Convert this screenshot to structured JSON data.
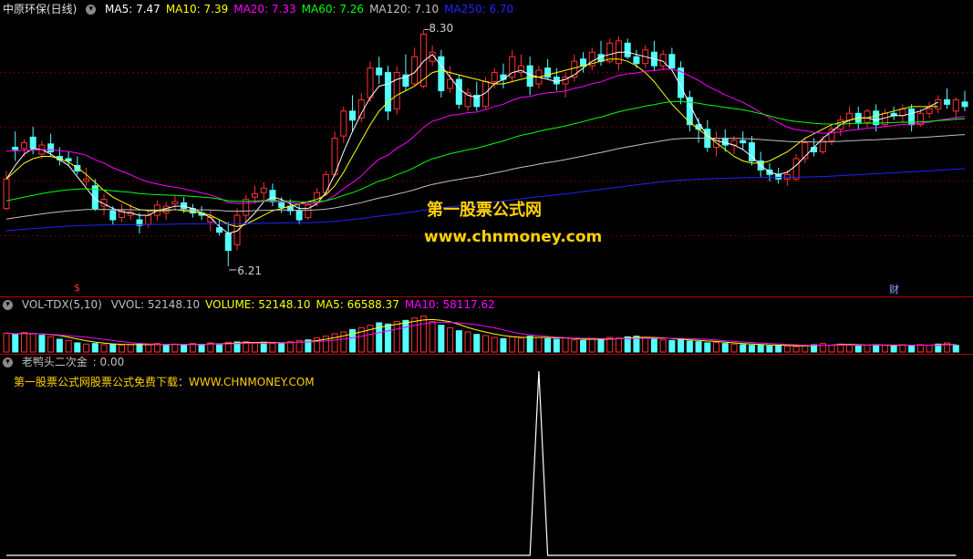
{
  "price_panel": {
    "stock_name": "中原环保(日线)",
    "indicators": [
      {
        "label": "MA5: 7.47",
        "color": "#ffffff"
      },
      {
        "label": "MA10: 7.39",
        "color": "#ffff00"
      },
      {
        "label": "MA20: 7.33",
        "color": "#ff00ff"
      },
      {
        "label": "MA60: 7.26",
        "color": "#00ff00"
      },
      {
        "label": "MA120: 7.10",
        "color": "#c0c0c0"
      },
      {
        "label": "MA250: 6.70",
        "color": "#2222ff"
      }
    ],
    "high_label": "8.30",
    "low_label": "6.21",
    "marker_left": "$",
    "marker_right": "财",
    "watermark_cn": "第一股票公式网",
    "watermark_url": "www.chnmoney.com",
    "colors": {
      "up": "#ff3232",
      "down": "#54ffff",
      "background": "#000000"
    }
  },
  "volume_panel": {
    "name": "VOL-TDX(5,10)",
    "indicators": [
      {
        "label": "VVOL: 52148.10",
        "color": "#c0c0c0"
      },
      {
        "label": "VOLUME: 52148.10",
        "color": "#ffff00"
      },
      {
        "label": "MA5: 66588.37",
        "color": "#ffff00"
      },
      {
        "label": "MA10: 58117.62",
        "color": "#ff00ff"
      }
    ]
  },
  "indicator_panel": {
    "name": "老鸭头二次金",
    "value": ": 0.00",
    "note": "第一股票公式网股票公式免费下载：WWW.CHNMONEY.COM"
  },
  "chart_data": [
    {
      "type": "candlestick",
      "title": "中原环保(日线)",
      "ylim": [
        6.0,
        8.4
      ],
      "candles_ohlc": [
        [
          6.72,
          7.05,
          6.7,
          6.98
        ],
        [
          7.26,
          7.4,
          7.14,
          7.24
        ],
        [
          7.25,
          7.33,
          7.18,
          7.3
        ],
        [
          7.35,
          7.44,
          7.2,
          7.25
        ],
        [
          7.2,
          7.32,
          7.16,
          7.28
        ],
        [
          7.29,
          7.38,
          7.18,
          7.22
        ],
        [
          7.18,
          7.26,
          7.1,
          7.15
        ],
        [
          7.16,
          7.22,
          7.1,
          7.14
        ],
        [
          7.1,
          7.18,
          7.02,
          7.05
        ],
        [
          6.96,
          7.08,
          6.92,
          6.98
        ],
        [
          6.92,
          6.98,
          6.7,
          6.72
        ],
        [
          6.74,
          6.85,
          6.66,
          6.8
        ],
        [
          6.7,
          6.74,
          6.58,
          6.62
        ],
        [
          6.64,
          6.76,
          6.6,
          6.7
        ],
        [
          6.66,
          6.76,
          6.62,
          6.69
        ],
        [
          6.62,
          6.68,
          6.5,
          6.57
        ],
        [
          6.58,
          6.7,
          6.55,
          6.66
        ],
        [
          6.66,
          6.79,
          6.61,
          6.75
        ],
        [
          6.68,
          6.78,
          6.62,
          6.74
        ],
        [
          6.76,
          6.84,
          6.7,
          6.78
        ],
        [
          6.77,
          6.82,
          6.68,
          6.72
        ],
        [
          6.72,
          6.76,
          6.64,
          6.68
        ],
        [
          6.68,
          6.74,
          6.62,
          6.66
        ],
        [
          6.6,
          6.7,
          6.52,
          6.64
        ],
        [
          6.55,
          6.62,
          6.48,
          6.51
        ],
        [
          6.5,
          6.6,
          6.21,
          6.35
        ],
        [
          6.4,
          6.72,
          6.35,
          6.66
        ],
        [
          6.66,
          6.84,
          6.6,
          6.8
        ],
        [
          6.82,
          6.92,
          6.76,
          6.85
        ],
        [
          6.86,
          6.95,
          6.8,
          6.9
        ],
        [
          6.88,
          6.94,
          6.74,
          6.78
        ],
        [
          6.77,
          6.82,
          6.68,
          6.73
        ],
        [
          6.74,
          6.8,
          6.66,
          6.7
        ],
        [
          6.7,
          6.76,
          6.58,
          6.62
        ],
        [
          6.64,
          6.78,
          6.62,
          6.75
        ],
        [
          6.77,
          6.9,
          6.74,
          6.86
        ],
        [
          6.86,
          7.05,
          6.84,
          7.02
        ],
        [
          7.02,
          7.4,
          7.0,
          7.34
        ],
        [
          7.36,
          7.62,
          7.3,
          7.58
        ],
        [
          7.58,
          7.72,
          7.4,
          7.5
        ],
        [
          7.52,
          7.74,
          7.48,
          7.68
        ],
        [
          7.7,
          8.02,
          7.66,
          7.96
        ],
        [
          7.96,
          8.06,
          7.82,
          7.9
        ],
        [
          7.92,
          7.98,
          7.5,
          7.58
        ],
        [
          7.6,
          7.98,
          7.55,
          7.92
        ],
        [
          7.9,
          8.08,
          7.76,
          7.8
        ],
        [
          7.82,
          8.14,
          7.8,
          8.06
        ],
        [
          7.8,
          8.3,
          7.78,
          8.26
        ],
        [
          8.02,
          8.16,
          7.98,
          8.1
        ],
        [
          8.06,
          8.12,
          7.7,
          7.76
        ],
        [
          7.78,
          7.98,
          7.74,
          7.86
        ],
        [
          7.86,
          7.9,
          7.6,
          7.64
        ],
        [
          7.62,
          7.78,
          7.58,
          7.74
        ],
        [
          7.72,
          7.84,
          7.58,
          7.62
        ],
        [
          7.62,
          7.88,
          7.6,
          7.84
        ],
        [
          7.84,
          7.96,
          7.78,
          7.92
        ],
        [
          7.9,
          8.0,
          7.78,
          7.86
        ],
        [
          7.88,
          8.12,
          7.84,
          8.06
        ],
        [
          7.92,
          8.08,
          7.88,
          7.98
        ],
        [
          7.98,
          8.06,
          7.72,
          7.8
        ],
        [
          7.82,
          7.98,
          7.78,
          7.94
        ],
        [
          7.96,
          8.04,
          7.86,
          7.88
        ],
        [
          7.88,
          7.96,
          7.76,
          7.82
        ],
        [
          7.82,
          7.92,
          7.7,
          7.88
        ],
        [
          7.88,
          8.08,
          7.84,
          8.02
        ],
        [
          8.04,
          8.1,
          7.92,
          7.98
        ],
        [
          7.98,
          8.14,
          7.94,
          8.1
        ],
        [
          8.08,
          8.2,
          7.98,
          8.02
        ],
        [
          8.02,
          8.22,
          8.0,
          8.18
        ],
        [
          8.0,
          8.24,
          7.94,
          8.2
        ],
        [
          8.18,
          8.22,
          8.04,
          8.06
        ],
        [
          8.06,
          8.12,
          7.96,
          8.0
        ],
        [
          8.0,
          8.16,
          7.96,
          8.12
        ],
        [
          8.1,
          8.2,
          7.94,
          7.98
        ],
        [
          7.98,
          8.12,
          7.94,
          8.08
        ],
        [
          8.08,
          8.14,
          7.94,
          7.96
        ],
        [
          7.96,
          8.02,
          7.64,
          7.7
        ],
        [
          7.7,
          7.76,
          7.4,
          7.46
        ],
        [
          7.46,
          7.52,
          7.3,
          7.42
        ],
        [
          7.42,
          7.5,
          7.22,
          7.26
        ],
        [
          7.26,
          7.4,
          7.18,
          7.34
        ],
        [
          7.34,
          7.42,
          7.22,
          7.28
        ],
        [
          7.28,
          7.36,
          7.2,
          7.32
        ],
        [
          7.32,
          7.4,
          7.24,
          7.3
        ],
        [
          7.3,
          7.36,
          7.1,
          7.14
        ],
        [
          7.14,
          7.22,
          7.0,
          7.06
        ],
        [
          7.06,
          7.12,
          6.96,
          7.02
        ],
        [
          7.02,
          7.08,
          6.94,
          6.98
        ],
        [
          6.98,
          7.06,
          6.92,
          7.02
        ],
        [
          6.98,
          7.2,
          6.96,
          7.16
        ],
        [
          7.16,
          7.34,
          7.12,
          7.3
        ],
        [
          7.26,
          7.34,
          7.18,
          7.22
        ],
        [
          7.22,
          7.36,
          7.2,
          7.32
        ],
        [
          7.32,
          7.46,
          7.28,
          7.42
        ],
        [
          7.42,
          7.54,
          7.36,
          7.5
        ],
        [
          7.5,
          7.62,
          7.44,
          7.56
        ],
        [
          7.56,
          7.62,
          7.42,
          7.48
        ],
        [
          7.48,
          7.6,
          7.44,
          7.58
        ],
        [
          7.58,
          7.64,
          7.4,
          7.46
        ],
        [
          7.46,
          7.6,
          7.44,
          7.56
        ],
        [
          7.56,
          7.62,
          7.5,
          7.54
        ],
        [
          7.54,
          7.64,
          7.48,
          7.6
        ],
        [
          7.6,
          7.64,
          7.4,
          7.46
        ],
        [
          7.46,
          7.6,
          7.44,
          7.56
        ],
        [
          7.56,
          7.66,
          7.52,
          7.6
        ],
        [
          7.6,
          7.72,
          7.56,
          7.68
        ],
        [
          7.68,
          7.78,
          7.6,
          7.64
        ],
        [
          7.58,
          7.7,
          7.5,
          7.68
        ],
        [
          7.66,
          7.76,
          7.58,
          7.62
        ]
      ],
      "moving_averages": {
        "MA5": [
          6.98,
          7.1,
          7.2,
          7.25,
          7.24,
          7.2,
          7.15,
          7.1,
          7.0,
          6.9,
          6.8,
          6.76,
          6.72,
          6.69,
          6.68,
          6.66,
          6.66,
          6.7,
          6.72,
          6.74,
          6.74,
          6.72,
          6.68,
          6.64,
          6.56,
          6.5,
          6.52,
          6.6,
          6.68,
          6.78,
          6.82,
          6.8,
          6.76,
          6.72,
          6.72,
          6.76,
          6.86,
          7.02,
          7.22,
          7.4,
          7.56,
          7.7,
          7.8,
          7.82,
          7.86,
          7.88,
          7.92,
          8.02,
          8.08,
          7.98,
          7.88,
          7.78,
          7.72,
          7.7,
          7.74,
          7.82,
          7.86,
          7.92,
          7.94,
          7.9,
          7.88,
          7.86,
          7.84,
          7.86,
          7.9,
          7.96,
          8.02,
          8.06,
          8.08,
          8.1,
          8.1,
          8.08,
          8.06,
          8.04,
          8.02,
          7.94,
          7.8,
          7.64,
          7.48,
          7.36,
          7.32,
          7.3,
          7.28,
          7.24,
          7.18,
          7.1,
          7.04,
          7.02,
          7.04,
          7.1,
          7.18,
          7.26,
          7.34,
          7.4,
          7.46,
          7.5,
          7.52,
          7.52,
          7.5,
          7.52,
          7.54,
          7.54,
          7.56,
          7.58,
          7.62,
          7.66
        ],
        "MA10": [
          6.98,
          7.05,
          7.12,
          7.16,
          7.18,
          7.18,
          7.16,
          7.13,
          7.08,
          7.02,
          6.95,
          6.88,
          6.82,
          6.78,
          6.74,
          6.71,
          6.7,
          6.7,
          6.7,
          6.71,
          6.7,
          6.69,
          6.68,
          6.66,
          6.62,
          6.58,
          6.56,
          6.58,
          6.62,
          6.66,
          6.7,
          6.72,
          6.74,
          6.76,
          6.78,
          6.8,
          6.84,
          6.92,
          7.04,
          7.18,
          7.32,
          7.46,
          7.58,
          7.66,
          7.72,
          7.76,
          7.8,
          7.86,
          7.92,
          7.94,
          7.92,
          7.9,
          7.88,
          7.86,
          7.84,
          7.82,
          7.82,
          7.84,
          7.86,
          7.88,
          7.88,
          7.9,
          7.92,
          7.94,
          7.96,
          7.98,
          8.0,
          8.02,
          8.04,
          8.04,
          8.02,
          7.98,
          7.92,
          7.84,
          7.74,
          7.64,
          7.56,
          7.48,
          7.42,
          7.36,
          7.3,
          7.24,
          7.18,
          7.14,
          7.12,
          7.12,
          7.14,
          7.18,
          7.22,
          7.28,
          7.34,
          7.38,
          7.42,
          7.46,
          7.48,
          7.5,
          7.52,
          7.52,
          7.54,
          7.56,
          7.58,
          7.6,
          7.62,
          7.62,
          7.62,
          7.62
        ]
      }
    },
    {
      "type": "bar",
      "title": "VOL-TDX(5,10)",
      "ylim": [
        0,
        120000
      ],
      "values": [
        62000,
        58000,
        64000,
        60000,
        55000,
        50000,
        42000,
        38000,
        30000,
        26000,
        28000,
        24000,
        26000,
        22000,
        24000,
        26000,
        24000,
        28000,
        22000,
        26000,
        24000,
        28000,
        25000,
        30000,
        27000,
        32000,
        33000,
        34000,
        30000,
        32000,
        28000,
        30000,
        34000,
        38000,
        40000,
        46000,
        52000,
        60000,
        66000,
        74000,
        80000,
        88000,
        96000,
        92000,
        100000,
        104000,
        112000,
        118000,
        100000,
        88000,
        80000,
        70000,
        66000,
        58000,
        54000,
        48000,
        44000,
        50000,
        46000,
        52000,
        48000,
        44000,
        42000,
        46000,
        40000,
        38000,
        44000,
        42000,
        48000,
        46000,
        50000,
        52000,
        46000,
        44000,
        40000,
        38000,
        42000,
        36000,
        34000,
        30000,
        32000,
        28000,
        26000,
        24000,
        22000,
        24000,
        20000,
        22000,
        20000,
        18000,
        22000,
        24000,
        28000,
        22000,
        26000,
        24000,
        20000,
        22000,
        24000,
        22000,
        20000,
        24000,
        22000,
        24000,
        22000,
        26000,
        30000,
        22000
      ],
      "up_flags": [
        1,
        0,
        1,
        1,
        0,
        1,
        0,
        1,
        0,
        1,
        0,
        1,
        0,
        1,
        1,
        0,
        1,
        1,
        0,
        1,
        0,
        1,
        0,
        1,
        0,
        1,
        0,
        1,
        1,
        0,
        1,
        0,
        1,
        1,
        0,
        1,
        1,
        1,
        1,
        0,
        1,
        1,
        0,
        0,
        1,
        0,
        1,
        1,
        1,
        0,
        1,
        0,
        1,
        0,
        1,
        1,
        0,
        1,
        1,
        0,
        1,
        0,
        0,
        1,
        1,
        0,
        1,
        0,
        1,
        1,
        0,
        0,
        1,
        0,
        1,
        0,
        0,
        0,
        0,
        0,
        1,
        0,
        1,
        0,
        0,
        0,
        0,
        0,
        1,
        1,
        1,
        0,
        1,
        1,
        1,
        1,
        0,
        1,
        0,
        1,
        0,
        1,
        0,
        1,
        1,
        0,
        1,
        0
      ]
    },
    {
      "type": "line",
      "title": "老鸭头二次金",
      "ylim": [
        0,
        1
      ],
      "values": [
        0,
        0,
        0,
        0,
        0,
        0,
        0,
        0,
        0,
        0,
        0,
        0,
        0,
        0,
        0,
        0,
        0,
        0,
        0,
        0,
        0,
        0,
        0,
        0,
        0,
        0,
        0,
        0,
        0,
        0,
        0,
        0,
        0,
        0,
        0,
        0,
        0,
        0,
        0,
        0,
        0,
        0,
        0,
        0,
        0,
        0,
        0,
        0,
        0,
        0,
        0,
        0,
        0,
        0,
        0,
        0,
        0,
        0,
        0,
        0,
        1,
        0,
        0,
        0,
        0,
        0,
        0,
        0,
        0,
        0,
        0,
        0,
        0,
        0,
        0,
        0,
        0,
        0,
        0,
        0,
        0,
        0,
        0,
        0,
        0,
        0,
        0,
        0,
        0,
        0,
        0,
        0,
        0,
        0,
        0,
        0,
        0,
        0,
        0,
        0,
        0,
        0,
        0,
        0,
        0,
        0,
        0,
        0
      ]
    }
  ]
}
